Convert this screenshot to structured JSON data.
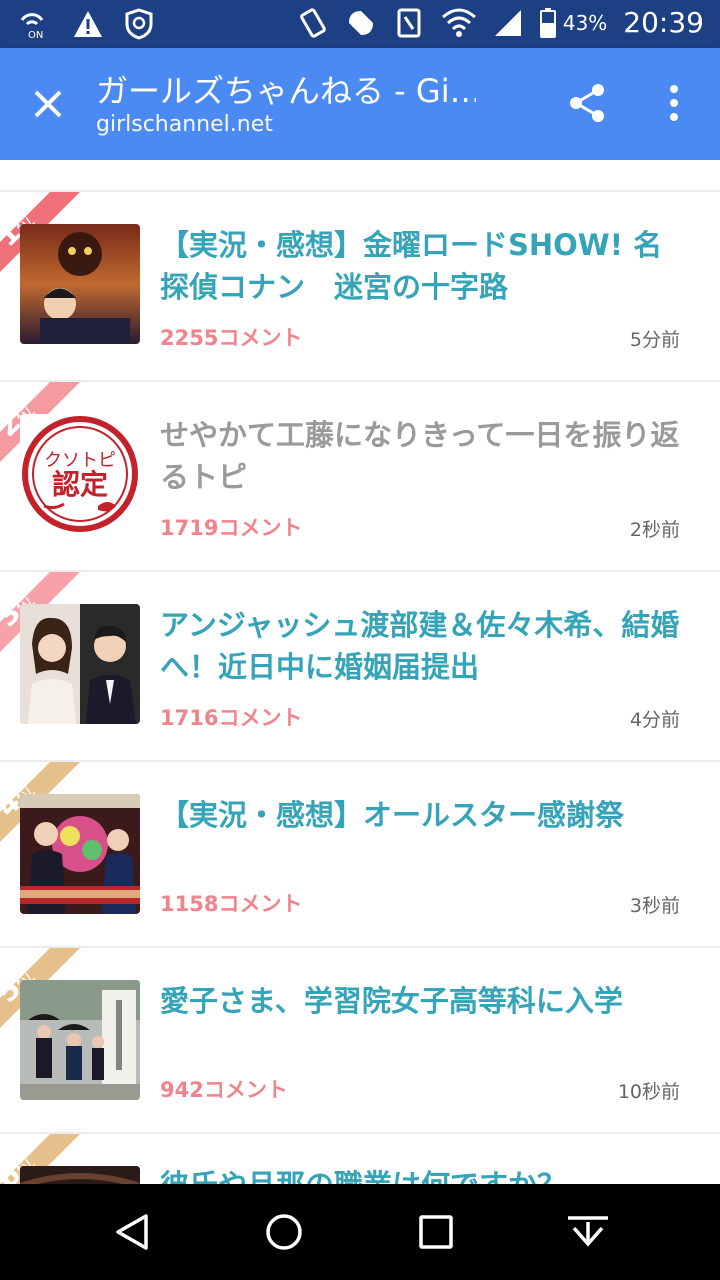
{
  "status_bar": {
    "icons": [
      "nfc-on-icon",
      "warning-icon",
      "shield-icon",
      "vibrate-icon",
      "data-saver-icon",
      "nfc-icon",
      "wifi-icon",
      "signal-icon",
      "battery-icon"
    ],
    "nfc_label": "ON",
    "battery": "43%",
    "time": "20:39"
  },
  "toolbar": {
    "title": "ガールズちゃんねる - Gi…",
    "url": "girlschannel.net",
    "color": "#4b8af2"
  },
  "items": [
    {
      "rank": "1",
      "rank_suffix": "位",
      "title": "【実況・感想】金曜ロードSHOW! 名探偵コナン　迷宮の十字路",
      "comments": "2255コメント",
      "time": "5分前",
      "thumb": "conan-movie-poster"
    },
    {
      "rank": "2",
      "rank_suffix": "位",
      "title": "せやかて工藤になりきって一日を振り返るトピ",
      "comments": "1719コメント",
      "time": "2秒前",
      "thumb": "kusotopi-nintei-stamp",
      "stamp_line1": "クソトピ",
      "stamp_line2": "認定"
    },
    {
      "rank": "3",
      "rank_suffix": "位",
      "title": "アンジャッシュ渡部建＆佐々木希、結婚へ！近日中に婚姻届提出",
      "comments": "1716コメント",
      "time": "4分前",
      "thumb": "couple-photo"
    },
    {
      "rank": "4",
      "rank_suffix": "位",
      "title": "【実況・感想】オールスター感謝祭",
      "comments": "1158コメント",
      "time": "3秒前",
      "thumb": "tv-show-photo"
    },
    {
      "rank": "5",
      "rank_suffix": "位",
      "title": "愛子さま、学習院女子高等科に入学",
      "comments": "942コメント",
      "time": "10秒前",
      "thumb": "ceremony-photo"
    },
    {
      "rank": "6",
      "rank_suffix": "位",
      "title": "彼氏や旦那の職業は何ですか？",
      "comments": "",
      "time": "",
      "thumb": "partial-photo"
    }
  ],
  "colors": {
    "rank_1": "#f0707a",
    "rank_2": "#f49aa0",
    "rank_3": "#f7a2a8",
    "rank_4": "#e6c08a",
    "rank_5": "#e6c08a",
    "rank_6": "#e6c08a",
    "title": "#36a4b8",
    "title_visited": "#9a9a9a",
    "comments": "#f0848c"
  },
  "nav_bar": {
    "icons": [
      "back-icon",
      "home-icon",
      "recents-icon",
      "hide-keyboard-icon"
    ]
  }
}
